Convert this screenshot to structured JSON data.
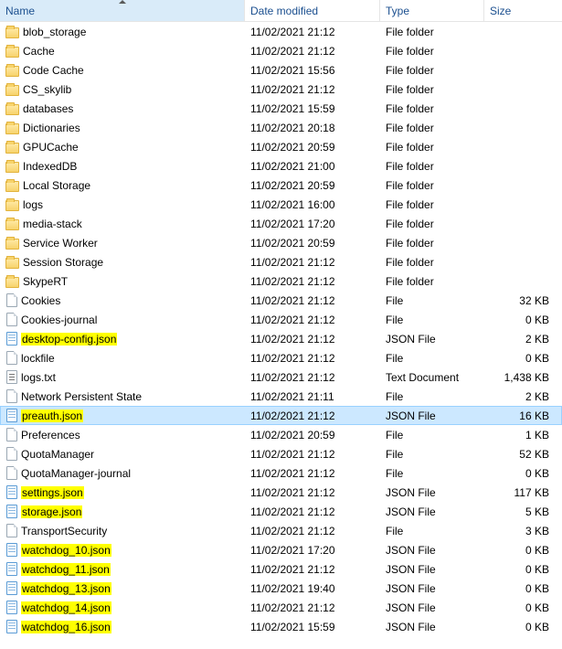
{
  "columns": {
    "name": "Name",
    "date": "Date modified",
    "type": "Type",
    "size": "Size"
  },
  "sort": {
    "column": "name",
    "dir": "asc"
  },
  "rows": [
    {
      "name": "blob_storage",
      "date": "11/02/2021 21:12",
      "type": "File folder",
      "size": "",
      "icon": "folder",
      "hl": false,
      "sel": false
    },
    {
      "name": "Cache",
      "date": "11/02/2021 21:12",
      "type": "File folder",
      "size": "",
      "icon": "folder",
      "hl": false,
      "sel": false
    },
    {
      "name": "Code Cache",
      "date": "11/02/2021 15:56",
      "type": "File folder",
      "size": "",
      "icon": "folder",
      "hl": false,
      "sel": false
    },
    {
      "name": "CS_skylib",
      "date": "11/02/2021 21:12",
      "type": "File folder",
      "size": "",
      "icon": "folder",
      "hl": false,
      "sel": false
    },
    {
      "name": "databases",
      "date": "11/02/2021 15:59",
      "type": "File folder",
      "size": "",
      "icon": "folder",
      "hl": false,
      "sel": false
    },
    {
      "name": "Dictionaries",
      "date": "11/02/2021 20:18",
      "type": "File folder",
      "size": "",
      "icon": "folder",
      "hl": false,
      "sel": false
    },
    {
      "name": "GPUCache",
      "date": "11/02/2021 20:59",
      "type": "File folder",
      "size": "",
      "icon": "folder",
      "hl": false,
      "sel": false
    },
    {
      "name": "IndexedDB",
      "date": "11/02/2021 21:00",
      "type": "File folder",
      "size": "",
      "icon": "folder",
      "hl": false,
      "sel": false
    },
    {
      "name": "Local Storage",
      "date": "11/02/2021 20:59",
      "type": "File folder",
      "size": "",
      "icon": "folder",
      "hl": false,
      "sel": false
    },
    {
      "name": "logs",
      "date": "11/02/2021 16:00",
      "type": "File folder",
      "size": "",
      "icon": "folder",
      "hl": false,
      "sel": false
    },
    {
      "name": "media-stack",
      "date": "11/02/2021 17:20",
      "type": "File folder",
      "size": "",
      "icon": "folder",
      "hl": false,
      "sel": false
    },
    {
      "name": "Service Worker",
      "date": "11/02/2021 20:59",
      "type": "File folder",
      "size": "",
      "icon": "folder",
      "hl": false,
      "sel": false
    },
    {
      "name": "Session Storage",
      "date": "11/02/2021 21:12",
      "type": "File folder",
      "size": "",
      "icon": "folder",
      "hl": false,
      "sel": false
    },
    {
      "name": "SkypeRT",
      "date": "11/02/2021 21:12",
      "type": "File folder",
      "size": "",
      "icon": "folder",
      "hl": false,
      "sel": false
    },
    {
      "name": "Cookies",
      "date": "11/02/2021 21:12",
      "type": "File",
      "size": "32 KB",
      "icon": "file",
      "hl": false,
      "sel": false
    },
    {
      "name": "Cookies-journal",
      "date": "11/02/2021 21:12",
      "type": "File",
      "size": "0 KB",
      "icon": "file",
      "hl": false,
      "sel": false
    },
    {
      "name": "desktop-config.json",
      "date": "11/02/2021 21:12",
      "type": "JSON File",
      "size": "2 KB",
      "icon": "json",
      "hl": true,
      "sel": false
    },
    {
      "name": "lockfile",
      "date": "11/02/2021 21:12",
      "type": "File",
      "size": "0 KB",
      "icon": "file",
      "hl": false,
      "sel": false
    },
    {
      "name": "logs.txt",
      "date": "11/02/2021 21:12",
      "type": "Text Document",
      "size": "1,438 KB",
      "icon": "text",
      "hl": false,
      "sel": false
    },
    {
      "name": "Network Persistent State",
      "date": "11/02/2021 21:11",
      "type": "File",
      "size": "2 KB",
      "icon": "file",
      "hl": false,
      "sel": false
    },
    {
      "name": "preauth.json",
      "date": "11/02/2021 21:12",
      "type": "JSON File",
      "size": "16 KB",
      "icon": "json",
      "hl": true,
      "sel": true
    },
    {
      "name": "Preferences",
      "date": "11/02/2021 20:59",
      "type": "File",
      "size": "1 KB",
      "icon": "file",
      "hl": false,
      "sel": false
    },
    {
      "name": "QuotaManager",
      "date": "11/02/2021 21:12",
      "type": "File",
      "size": "52 KB",
      "icon": "file",
      "hl": false,
      "sel": false
    },
    {
      "name": "QuotaManager-journal",
      "date": "11/02/2021 21:12",
      "type": "File",
      "size": "0 KB",
      "icon": "file",
      "hl": false,
      "sel": false
    },
    {
      "name": "settings.json",
      "date": "11/02/2021 21:12",
      "type": "JSON File",
      "size": "117 KB",
      "icon": "json",
      "hl": true,
      "sel": false
    },
    {
      "name": "storage.json",
      "date": "11/02/2021 21:12",
      "type": "JSON File",
      "size": "5 KB",
      "icon": "json",
      "hl": true,
      "sel": false
    },
    {
      "name": "TransportSecurity",
      "date": "11/02/2021 21:12",
      "type": "File",
      "size": "3 KB",
      "icon": "file",
      "hl": false,
      "sel": false
    },
    {
      "name": "watchdog_10.json",
      "date": "11/02/2021 17:20",
      "type": "JSON File",
      "size": "0 KB",
      "icon": "json",
      "hl": true,
      "sel": false
    },
    {
      "name": "watchdog_11.json",
      "date": "11/02/2021 21:12",
      "type": "JSON File",
      "size": "0 KB",
      "icon": "json",
      "hl": true,
      "sel": false
    },
    {
      "name": "watchdog_13.json",
      "date": "11/02/2021 19:40",
      "type": "JSON File",
      "size": "0 KB",
      "icon": "json",
      "hl": true,
      "sel": false
    },
    {
      "name": "watchdog_14.json",
      "date": "11/02/2021 21:12",
      "type": "JSON File",
      "size": "0 KB",
      "icon": "json",
      "hl": true,
      "sel": false
    },
    {
      "name": "watchdog_16.json",
      "date": "11/02/2021 15:59",
      "type": "JSON File",
      "size": "0 KB",
      "icon": "json",
      "hl": true,
      "sel": false
    }
  ]
}
